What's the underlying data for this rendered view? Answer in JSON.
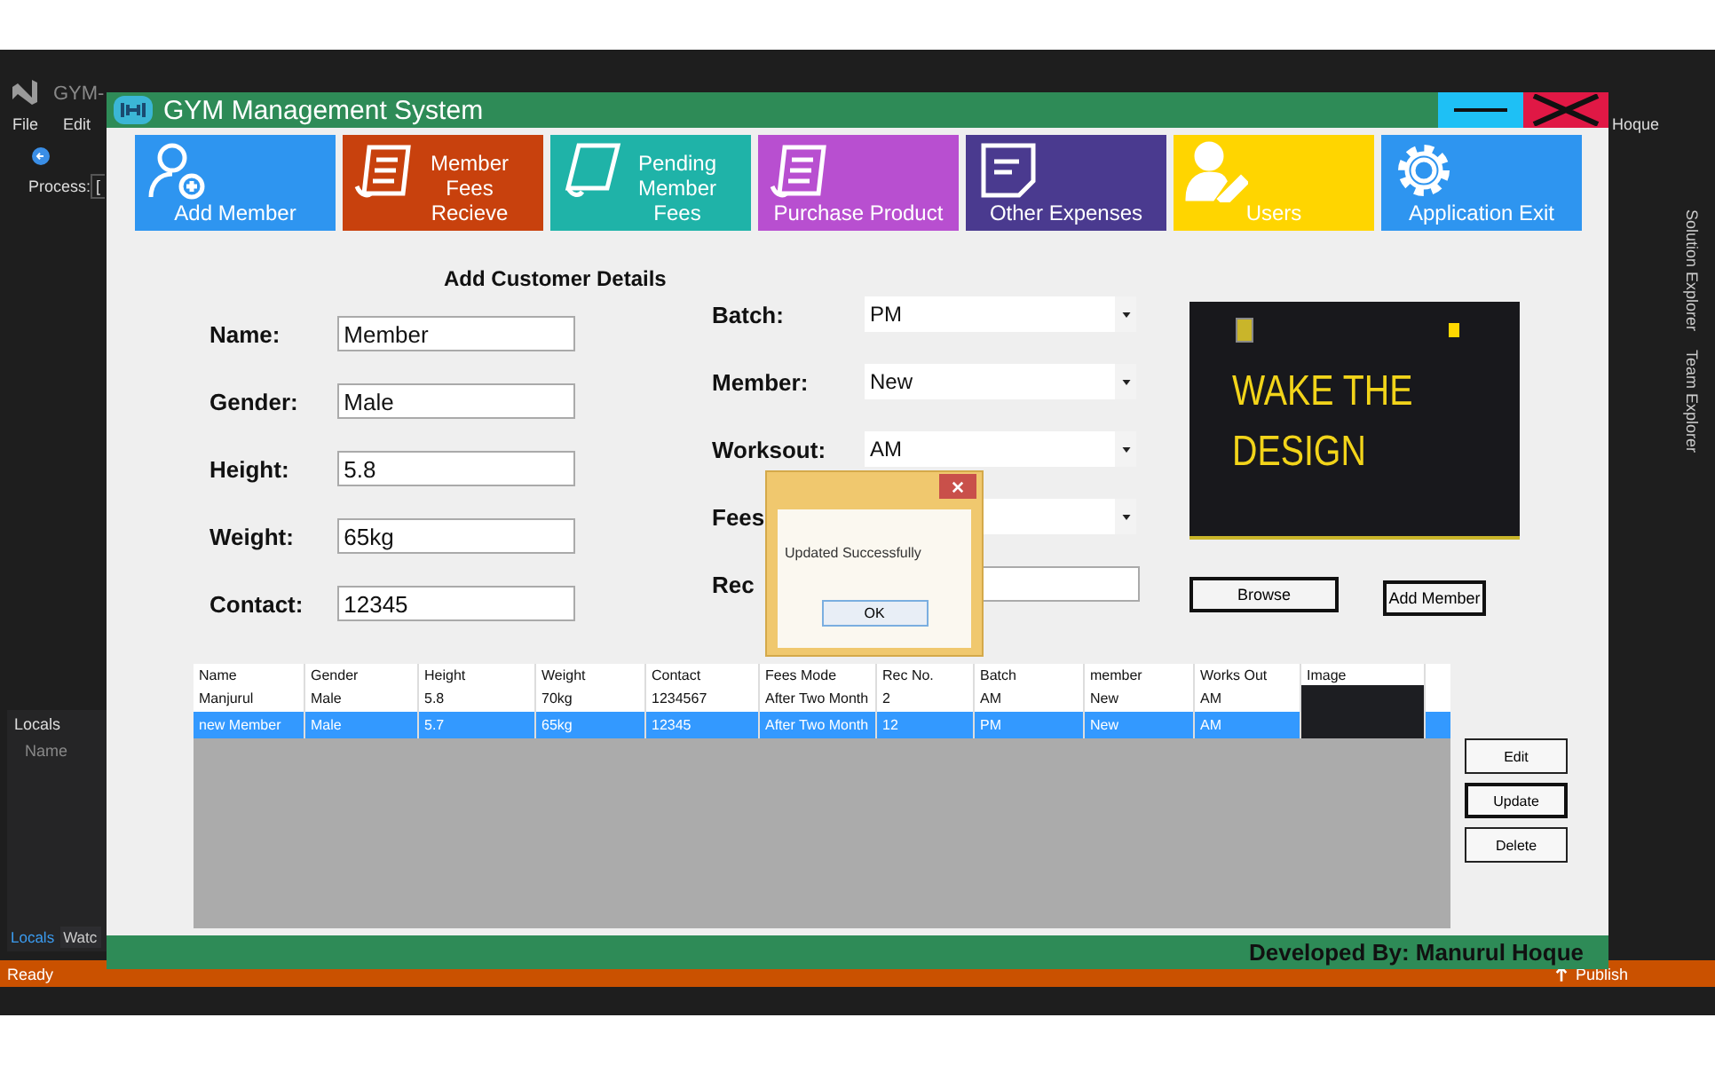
{
  "ide": {
    "title": "GYM-",
    "menu": [
      "File",
      "Edit"
    ],
    "process_label": "Process:",
    "process_value": "[",
    "account": "Hoque",
    "locals_title": "Locals",
    "locals_column": "Name",
    "bottom_tabs": [
      {
        "label": "Locals",
        "selected": true
      },
      {
        "label": "Watc",
        "selected": false
      }
    ],
    "side_tabs": [
      "Solution Explorer",
      "Team Explorer"
    ],
    "status": "Ready",
    "publish": "Publish"
  },
  "window": {
    "title": "GYM Management System",
    "footer": "Developed By: Manurul Hoque"
  },
  "tiles": [
    {
      "label": "Add Member",
      "color": "#2e95f0",
      "kind": "user-add"
    },
    {
      "label": "Member\nFees\nRecieve",
      "color": "#c8410d",
      "kind": "receipt"
    },
    {
      "label": "Pending\nMember\nFees",
      "color": "#1fb3a8",
      "kind": "page"
    },
    {
      "label": "Purchase Product",
      "color": "#b84fd0",
      "kind": "receipt"
    },
    {
      "label": "Other Expenses",
      "color": "#4a3a8f",
      "kind": "note"
    },
    {
      "label": "Users",
      "color": "#ffd500",
      "kind": "user-edit"
    },
    {
      "label": "Application Exit",
      "color": "#2e95f0",
      "kind": "gear"
    }
  ],
  "form": {
    "title": "Add Customer Details",
    "left": [
      {
        "label": "Name:",
        "value": "Member"
      },
      {
        "label": "Gender:",
        "value": "Male"
      },
      {
        "label": "Height:",
        "value": "5.8"
      },
      {
        "label": "Weight:",
        "value": "65kg"
      },
      {
        "label": "Contact:",
        "value": "12345"
      }
    ],
    "right": [
      {
        "label": "Batch:",
        "value": "PM",
        "kind": "combo"
      },
      {
        "label": "Member:",
        "value": "New",
        "kind": "combo"
      },
      {
        "label": "Worksout:",
        "value": "AM",
        "kind": "combo"
      },
      {
        "label": "Fees",
        "kind": "combo"
      },
      {
        "label": "Rec",
        "kind": "text"
      }
    ]
  },
  "preview": {
    "headline": [
      "WAKE THE",
      "DESIGN"
    ],
    "buttons": [
      "Browse",
      "Add Member"
    ]
  },
  "table": {
    "columns": [
      "Name",
      "Gender",
      "Height",
      "Weight",
      "Contact",
      "Fees Mode",
      "Rec No.",
      "Batch",
      "member",
      "Works Out",
      "Image"
    ],
    "rows": [
      {
        "cells": [
          "Manjurul",
          "Male",
          "5.8",
          "70kg",
          "1234567",
          "After Two Month",
          "2",
          "AM",
          "New",
          "AM"
        ],
        "selected": false
      },
      {
        "cells": [
          "new Member",
          "Male",
          "5.7",
          "65kg",
          "12345",
          "After Two Month",
          "12",
          "PM",
          "New",
          "AM"
        ],
        "selected": true
      }
    ]
  },
  "actions": [
    {
      "label": "Edit",
      "focused": false
    },
    {
      "label": "Update",
      "focused": true
    },
    {
      "label": "Delete",
      "focused": false
    }
  ],
  "dialog": {
    "message": "Updated Successfully",
    "button": "OK"
  }
}
